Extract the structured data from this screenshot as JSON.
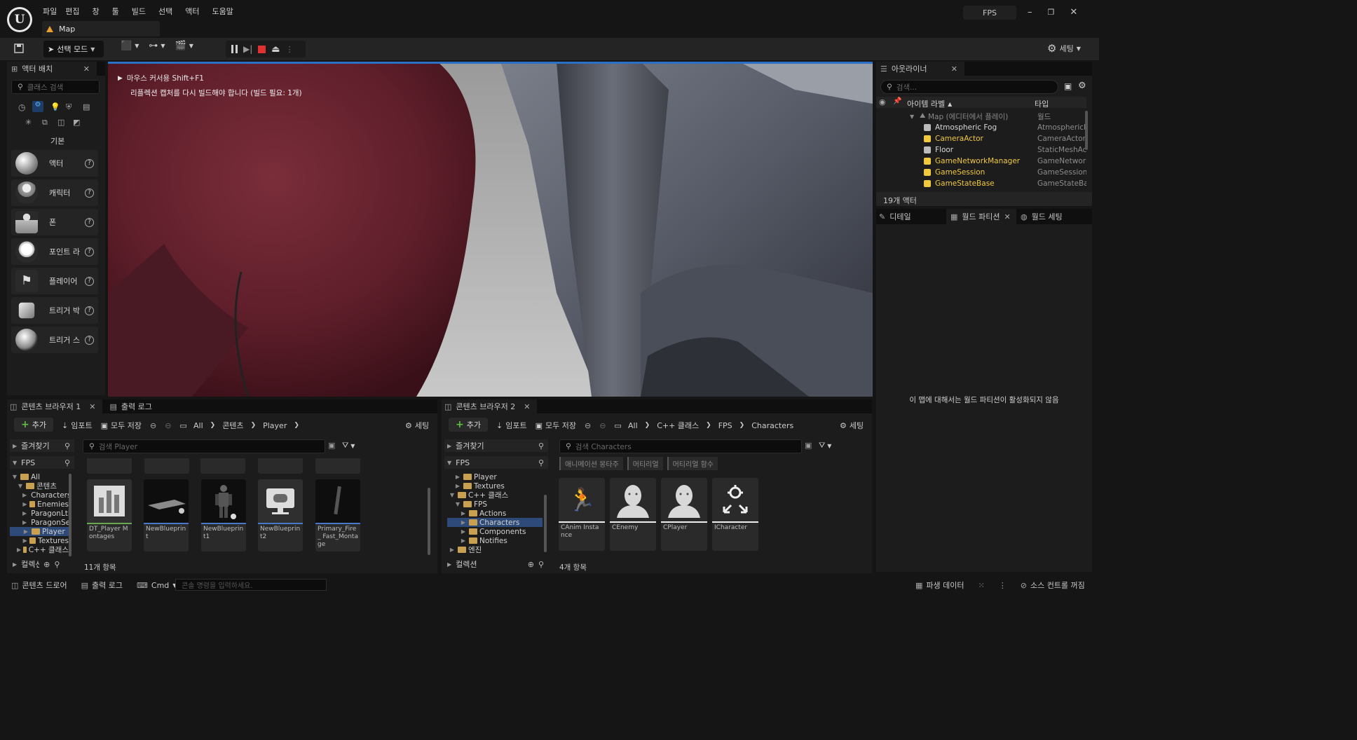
{
  "menubar": {
    "items": [
      "파일",
      "편집",
      "창",
      "툴",
      "빌드",
      "선택",
      "액터",
      "도움말"
    ],
    "project": "FPS",
    "level_tab": "Map"
  },
  "toolbar": {
    "mode_label": "선택 모드",
    "settings_label": "세팅"
  },
  "viewport": {
    "hint_text": "마우스 커서용 Shift+F1",
    "warning_text": "리플렉션 캡처를 다시 빌드해야 합니다 (빌드 필요: 1개)"
  },
  "place_actors": {
    "tab_label": "액터 배치",
    "search_placeholder": "클래스 검색",
    "category_label": "기본",
    "items": [
      {
        "label": "액터"
      },
      {
        "label": "캐릭터"
      },
      {
        "label": "폰"
      },
      {
        "label": "포인트 라이트"
      },
      {
        "label": "플레이어 스타트"
      },
      {
        "label": "트리거 박스"
      },
      {
        "label": "트리거 스피어"
      }
    ]
  },
  "outliner": {
    "tab_label": "아웃라이너",
    "search_placeholder": "검색...",
    "col_label": "아이템 라벨",
    "col_type": "타입",
    "root": {
      "name": "Map (에디터에서 플레이)",
      "type": "월드"
    },
    "rows": [
      {
        "name": "Atmospheric Fog",
        "type": "AtmosphericFog",
        "color": "#d8d8d8"
      },
      {
        "name": "CameraActor",
        "type": "CameraActor",
        "color": "#f0c840"
      },
      {
        "name": "Floor",
        "type": "StaticMeshActor",
        "color": "#d8d8d8"
      },
      {
        "name": "GameNetworkManager",
        "type": "GameNetworkManager",
        "color": "#f0c840"
      },
      {
        "name": "GameSession",
        "type": "GameSession",
        "color": "#f0c840"
      },
      {
        "name": "GameStateBase",
        "type": "GameStateBase",
        "color": "#f0c840"
      }
    ],
    "count_label": "19개 액터"
  },
  "details": {
    "tabs": [
      "디테일",
      "월드 파티션",
      "월드 세팅"
    ],
    "empty_message": "이 맵에 대해서는 월드 파티션이 활성화되지 않음"
  },
  "content_browser_1": {
    "tab_label": "콘텐츠 브라우저 1",
    "output_tab": "출력 로그",
    "add_label": "추가",
    "import_label": "임포트",
    "save_all_label": "모두 저장",
    "settings_label": "세팅",
    "path": [
      "All",
      "콘텐츠",
      "Player"
    ],
    "favorites_label": "즐겨찾기",
    "root_label": "FPS",
    "search_placeholder": "검색 Player",
    "tree": [
      {
        "label": "All",
        "indent": 0,
        "open": true
      },
      {
        "label": "콘텐츠",
        "indent": 1,
        "open": true
      },
      {
        "label": "Characters",
        "indent": 2,
        "open": false
      },
      {
        "label": "Enemies",
        "indent": 2,
        "open": false
      },
      {
        "label": "ParagonLtBelica",
        "indent": 2,
        "open": false
      },
      {
        "label": "ParagonSerath",
        "indent": 2,
        "open": false
      },
      {
        "label": "Player",
        "indent": 2,
        "open": false,
        "selected": true
      },
      {
        "label": "Textures",
        "indent": 2,
        "open": false
      },
      {
        "label": "C++ 클래스",
        "indent": 1,
        "open": false
      }
    ],
    "collections_label": "컬렉션",
    "assets": [
      {
        "label": "DT_Player Montages",
        "bar": "#6aa84f"
      },
      {
        "label": "NewBlueprint",
        "bar": "#4a78c8"
      },
      {
        "label": "NewBlueprint1",
        "bar": "#4a78c8"
      },
      {
        "label": "NewBlueprint2",
        "bar": "#4a78c8"
      },
      {
        "label": "Primary_Fire_ Fast_Montage",
        "bar": "#4a78c8"
      }
    ],
    "count_label": "11개 항목"
  },
  "content_browser_2": {
    "tab_label": "콘텐츠 브라우저 2",
    "add_label": "추가",
    "import_label": "임포트",
    "save_all_label": "모두 저장",
    "settings_label": "세팅",
    "path": [
      "All",
      "C++ 클래스",
      "FPS",
      "Characters"
    ],
    "favorites_label": "즐겨찾기",
    "root_label": "FPS",
    "search_placeholder": "검색 Characters",
    "filters": [
      "애니메이션 몽타주",
      "머티리얼",
      "머티리얼 함수"
    ],
    "tree": [
      {
        "label": "Player",
        "indent": 1,
        "open": false
      },
      {
        "label": "Textures",
        "indent": 1,
        "open": false
      },
      {
        "label": "C++ 클래스",
        "indent": 0,
        "open": true
      },
      {
        "label": "FPS",
        "indent": 1,
        "open": true
      },
      {
        "label": "Actions",
        "indent": 2,
        "open": false
      },
      {
        "label": "Characters",
        "indent": 2,
        "open": false,
        "selected": true
      },
      {
        "label": "Components",
        "indent": 2,
        "open": false
      },
      {
        "label": "Notifies",
        "indent": 2,
        "open": false
      },
      {
        "label": "엔진",
        "indent": 0,
        "open": false
      }
    ],
    "collections_label": "컬렉션",
    "assets": [
      {
        "label": "CAnim Instance"
      },
      {
        "label": "CEnemy"
      },
      {
        "label": "CPlayer"
      },
      {
        "label": "ICharacter"
      }
    ],
    "count_label": "4개 항목"
  },
  "statusbar": {
    "content_drawer": "콘텐츠 드로어",
    "output_log": "출력 로그",
    "cmd": "Cmd",
    "console_placeholder": "콘솔 명령을 입력하세요.",
    "derived_data": "파생 데이터",
    "source_control": "소스 컨트롤 꺼짐"
  }
}
